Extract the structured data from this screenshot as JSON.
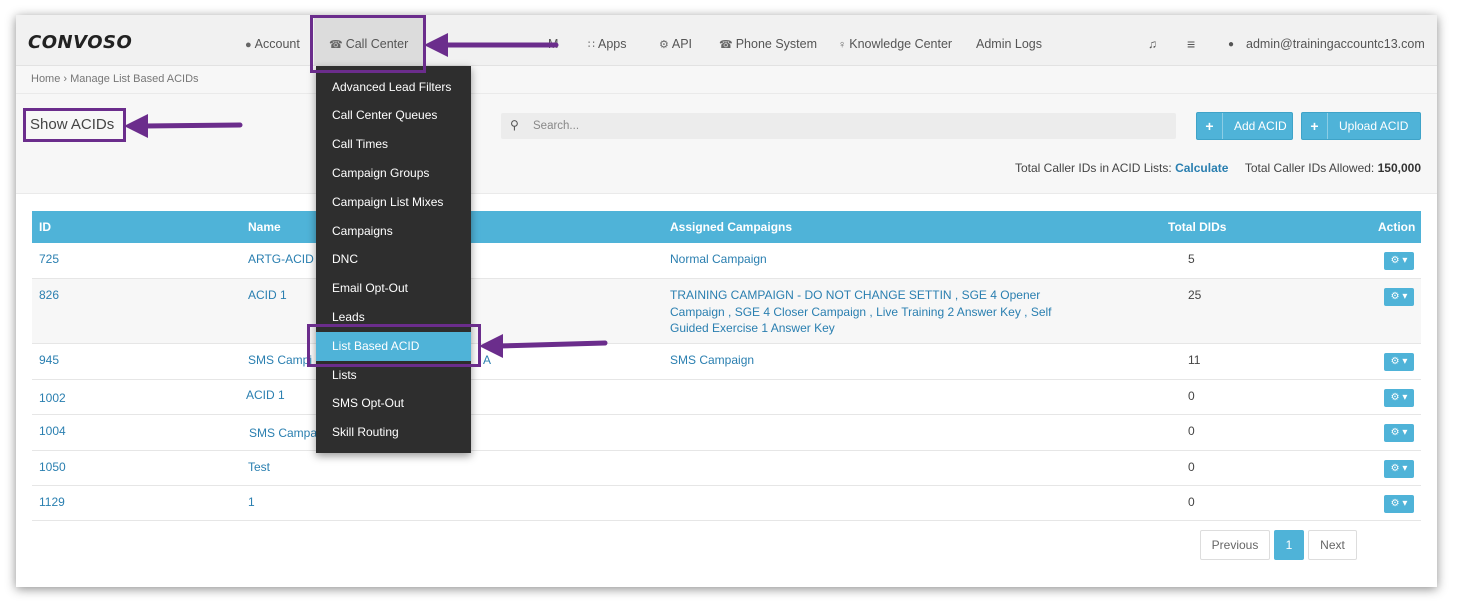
{
  "app": {
    "logo": "CONVOSO"
  },
  "nav": {
    "items": [
      {
        "label": "Account",
        "icon": "user-icon",
        "glyph": "●"
      },
      {
        "label": "Call Center",
        "icon": "phone-icon",
        "glyph": "☎"
      },
      {
        "label": "M",
        "icon": "",
        "glyph": ""
      },
      {
        "label": "Apps",
        "icon": "grid-icon",
        "glyph": "∷"
      },
      {
        "label": "API",
        "icon": "gear-icon",
        "glyph": "⚙"
      },
      {
        "label": "Phone System",
        "icon": "phone-icon",
        "glyph": "☎"
      },
      {
        "label": "Knowledge Center",
        "icon": "lightbulb-icon",
        "glyph": "♀"
      },
      {
        "label": "Admin Logs",
        "icon": "",
        "glyph": ""
      }
    ],
    "user": "admin@trainingaccountc13.com",
    "bell_glyph": "♫",
    "db_glyph": "≡",
    "user_glyph": "●"
  },
  "breadcrumb": {
    "home": "Home",
    "sep": "›",
    "current": "Manage List Based ACIDs"
  },
  "page": {
    "title": "Show ACIDs"
  },
  "search": {
    "placeholder": "Search...",
    "glyph": "⚲"
  },
  "buttons": {
    "add": "Add ACID",
    "upload": "Upload ACID",
    "plus": "+"
  },
  "totals": {
    "in_lists_label": "Total Caller IDs in ACID Lists:",
    "calculate": "Calculate",
    "allowed_label": "Total Caller IDs Allowed:",
    "allowed_value": "150,000"
  },
  "table": {
    "headers": {
      "id": "ID",
      "name": "Name",
      "campaigns": "Assigned Campaigns",
      "dids": "Total DIDs",
      "action": "Action"
    },
    "rows": [
      {
        "id": "725",
        "name": "ARTG-ACID",
        "campaigns": "Normal Campaign",
        "dids": "5"
      },
      {
        "id": "826",
        "name": "ACID 1",
        "campaigns": "TRAINING CAMPAIGN - DO NOT CHANGE SETTIN , SGE 4 Opener Campaign , SGE 4 Closer Campaign , Live Training 2 Answer Key , Self Guided Exercise 1 Answer Key",
        "dids": "25"
      },
      {
        "id": "945",
        "name": "SMS Campi",
        "campaigns": "SMS Campaign",
        "dids": "11"
      },
      {
        "id": "1002",
        "name": "ACID 1",
        "campaigns": "",
        "dids": "0"
      },
      {
        "id": "1004",
        "name": "SMS Campai",
        "campaigns": "",
        "dids": "0"
      },
      {
        "id": "1050",
        "name": "Test",
        "campaigns": "",
        "dids": "0"
      },
      {
        "id": "1129",
        "name": "1",
        "campaigns": "",
        "dids": "0"
      }
    ],
    "name_trailing_fragment": "A",
    "action_glyph": "⚙ ▾"
  },
  "pagination": {
    "previous": "Previous",
    "page": "1",
    "next": "Next"
  },
  "dropdown": {
    "items": [
      "Advanced Lead Filters",
      "Call Center Queues",
      "Call Times",
      "Campaign Groups",
      "Campaign List Mixes",
      "Campaigns",
      "DNC",
      "Email Opt-Out",
      "Leads",
      "List Based ACID",
      "Lists",
      "SMS Opt-Out",
      "Skill Routing"
    ],
    "selected": "List Based ACID"
  },
  "colors": {
    "accent": "#4fb3d8",
    "link": "#2a7fb0",
    "annotation": "#6b2d8c",
    "dropdown_bg": "#2e2e2e"
  }
}
